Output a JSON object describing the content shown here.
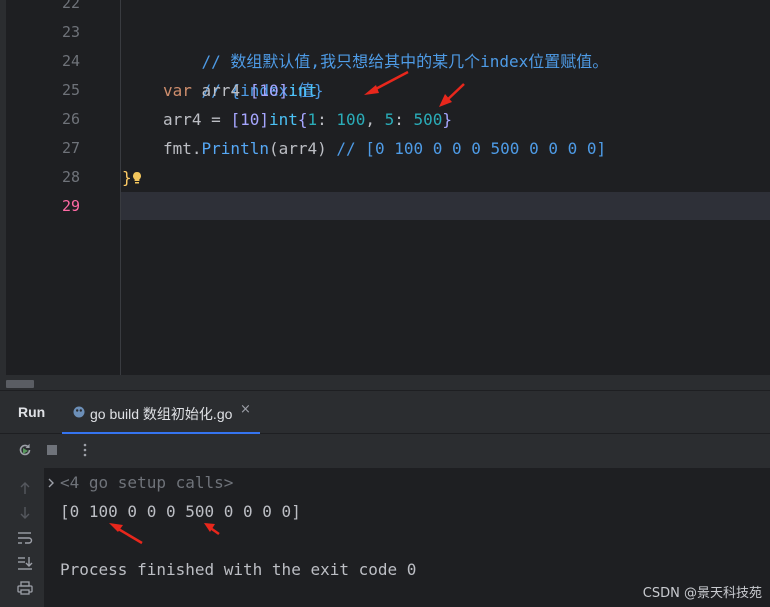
{
  "editor": {
    "line_numbers": [
      "22",
      "23",
      "24",
      "25",
      "26",
      "27",
      "28",
      "29"
    ],
    "current_line": "29",
    "lines": [
      {
        "comment": "// 数组默认值,我只想给其中的某几个index位置赋值。"
      },
      {
        "comment": "// {index:值}"
      },
      {
        "kw": "var",
        "name": " arr4 ",
        "bracket": "[10]",
        "type": "int"
      },
      {
        "name": "arr4 = ",
        "bracket": "[10]",
        "type": "int",
        "open": "{",
        "k1": "1",
        "sep1": ": ",
        "v1": "100",
        "comma": ", ",
        "k2": "5",
        "sep2": ": ",
        "v2": "500",
        "close": "}"
      },
      {
        "pkg": "fmt.",
        "fn": "Println",
        "args": "(arr4) ",
        "comment": "// [0 100 0 0 0 500 0 0 0 0]"
      },
      {
        "brace": "}"
      }
    ]
  },
  "run_panel": {
    "title": "Run",
    "tab_label": "go build 数组初始化.go",
    "tab_close": "×",
    "console": {
      "fold_text": "<4 go setup calls>",
      "output": "[0 100 0 0 0 500 0 0 0 0]",
      "process_line": "Process finished with the exit code 0"
    }
  },
  "watermark": "CSDN @景天科技苑",
  "colors": {
    "editor_bg": "#1e1f22",
    "panel_bg": "#2b2d30",
    "comment": "#4e9be6",
    "keyword": "#cf8e6d",
    "number": "#2aacb8",
    "current_line_number": "#ff6aa5",
    "annotation_arrow": "#e8271c"
  }
}
